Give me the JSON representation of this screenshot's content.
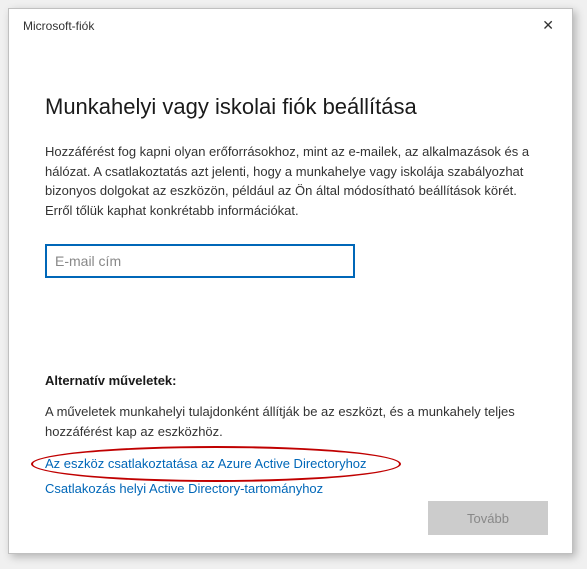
{
  "window": {
    "title": "Microsoft-fiók"
  },
  "main": {
    "heading": "Munkahelyi vagy iskolai fiók beállítása",
    "description": "Hozzáférést fog kapni olyan erőforrásokhoz, mint az e-mailek, az alkalmazások és a hálózat. A csatlakoztatás azt jelenti, hogy a munkahelye vagy iskolája szabályozhat bizonyos dolgokat az eszközön, például az Ön által módosítható beállítások körét. Erről tőlük kaphat konkrétabb információkat.",
    "email_placeholder": "E-mail cím"
  },
  "alt": {
    "heading": "Alternatív műveletek:",
    "description": "A műveletek munkahelyi tulajdonként állítják be az eszközt, és a munkahely teljes hozzáférést kap az eszközhöz.",
    "link_azure": "Az eszköz csatlakoztatása az Azure Active Directoryhoz",
    "link_local": "Csatlakozás helyi Active Directory-tartományhoz"
  },
  "footer": {
    "next_label": "Tovább"
  }
}
